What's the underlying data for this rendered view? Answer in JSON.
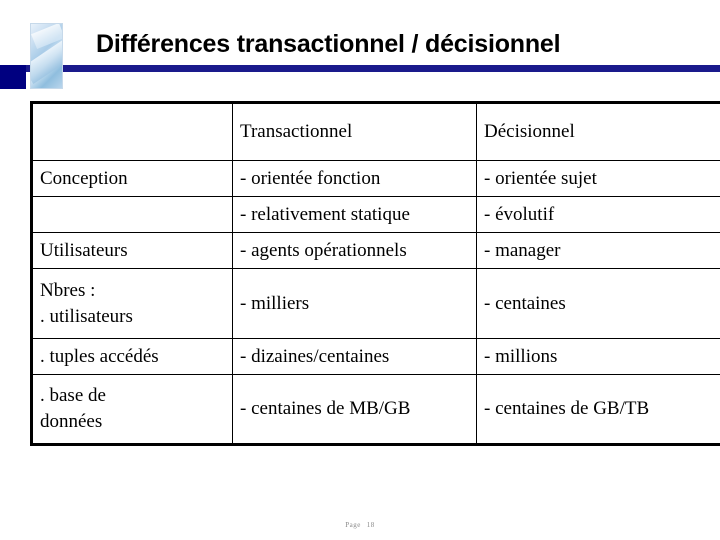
{
  "slide": {
    "title": "Différences transactionnel / décisionnel",
    "accent_color": "#000080",
    "rule_color": "#1a1a8c",
    "logo_name": "decorative-photo-chip"
  },
  "table": {
    "columns": [
      {
        "key": "label",
        "header": ""
      },
      {
        "key": "transactionnel",
        "header": "Transactionnel"
      },
      {
        "key": "decisionnel",
        "header": "Décisionnel"
      }
    ],
    "rows": [
      {
        "label": "Conception",
        "transactionnel": "- orientée fonction",
        "decisionnel": "- orientée sujet"
      },
      {
        "label": "",
        "transactionnel": "- relativement statique",
        "decisionnel": "- évolutif"
      },
      {
        "label": "Utilisateurs",
        "transactionnel": "- agents opérationnels",
        "decisionnel": "- manager"
      },
      {
        "label_line1": "Nbres :",
        "label_line2": ". utilisateurs",
        "transactionnel": "- milliers",
        "decisionnel": "- centaines"
      },
      {
        "label": ". tuples accédés",
        "transactionnel": "- dizaines/centaines",
        "decisionnel": "- millions"
      },
      {
        "label_line1": ". base de",
        "label_line2": "données",
        "transactionnel": "- centaines de MB/GB",
        "decisionnel": "- centaines de GB/TB"
      }
    ]
  },
  "footer": {
    "page_label": "Page",
    "page_number": "18"
  }
}
